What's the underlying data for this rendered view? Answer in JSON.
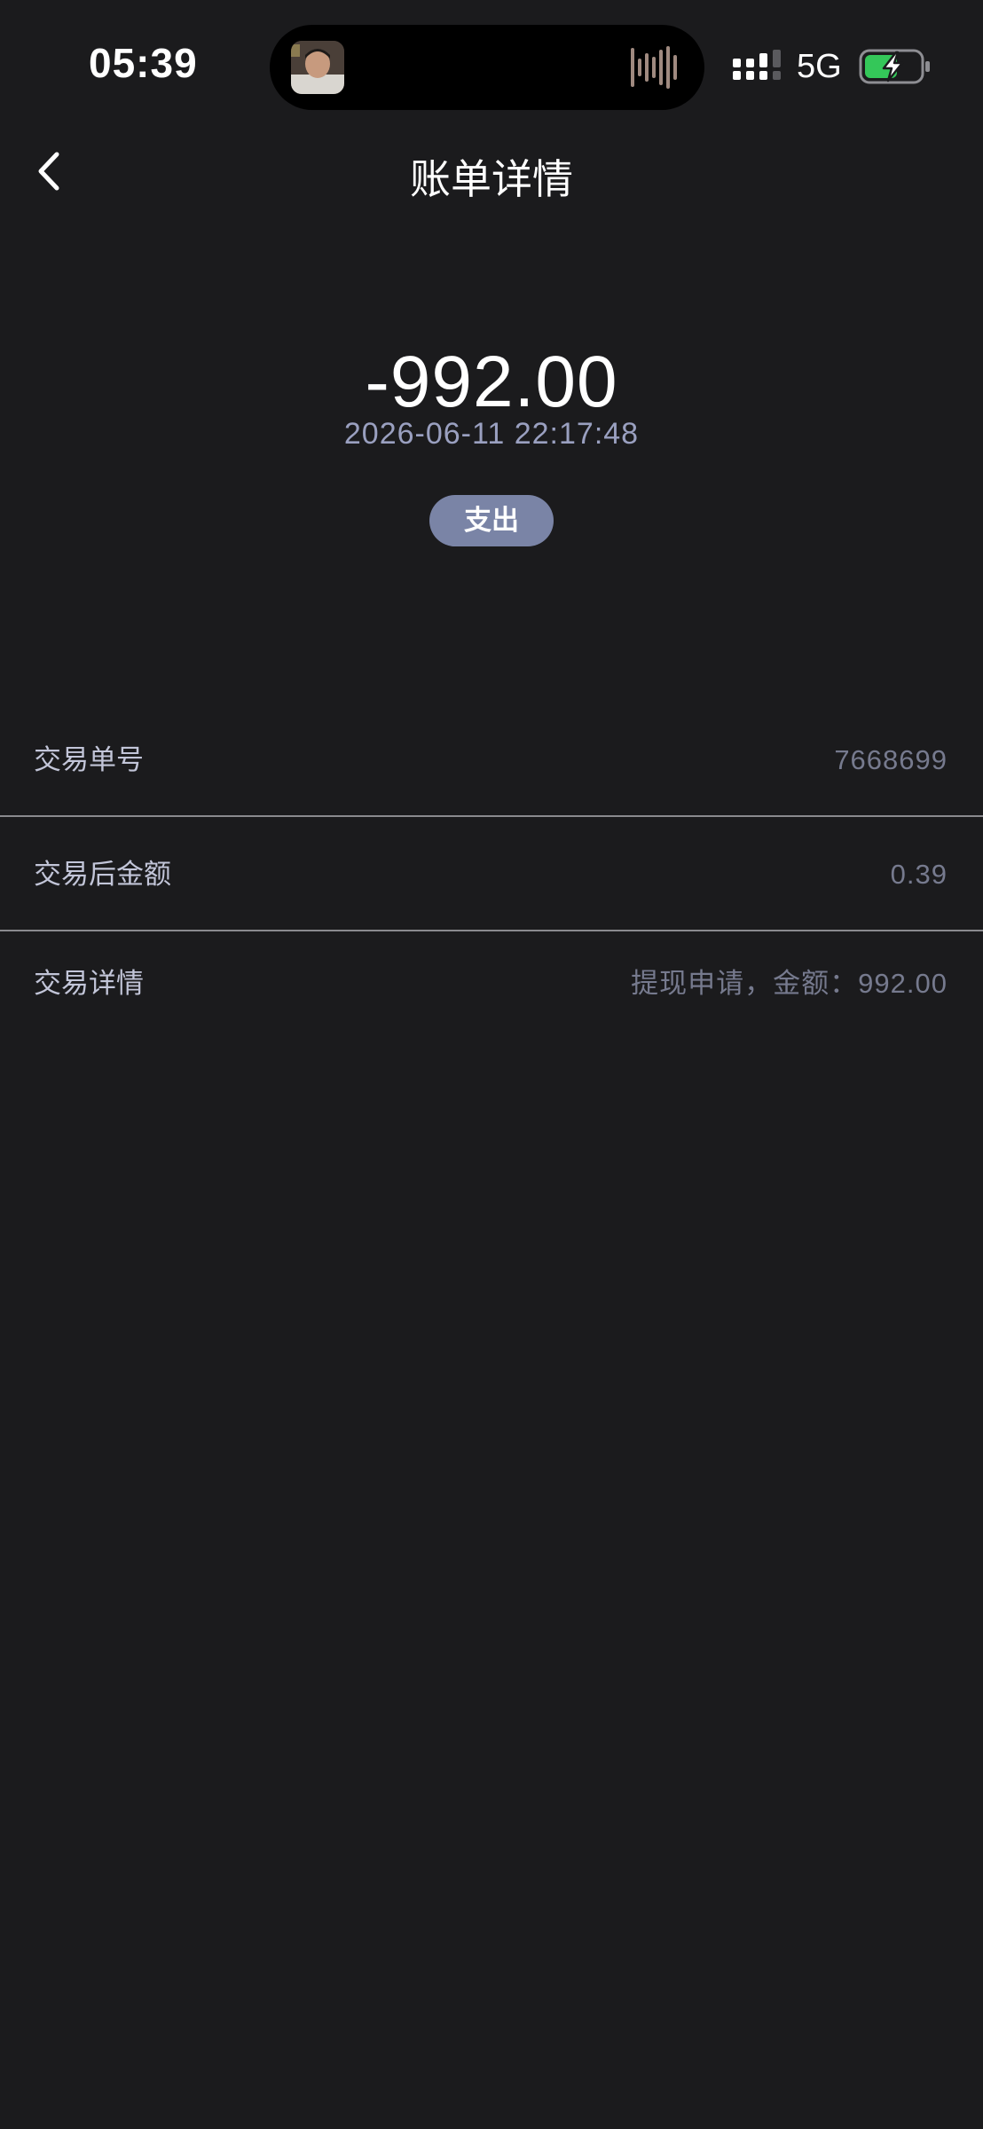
{
  "status_bar": {
    "time": "05:39",
    "network": "5G",
    "icons": [
      "signal-icon",
      "battery-charging-icon",
      "voice-wave-icon"
    ]
  },
  "nav": {
    "back_icon": "chevron-left-icon",
    "title": "账单详情"
  },
  "summary": {
    "amount": "-992.00",
    "datetime": "2026-06-11 22:17:48",
    "type": "支出"
  },
  "details": [
    {
      "label": "交易单号",
      "value": "7668699"
    },
    {
      "label": "交易后金额",
      "value": "0.39"
    },
    {
      "label": "交易详情",
      "value": "提现申请，金额：992.00"
    }
  ],
  "colors": {
    "background": "#1b1b1d",
    "badge": "#7a84a6",
    "date_text": "#9aa0c0",
    "label_text": "#c2c5d8",
    "value_text": "#767a8e",
    "battery_fill": "#34c759"
  }
}
